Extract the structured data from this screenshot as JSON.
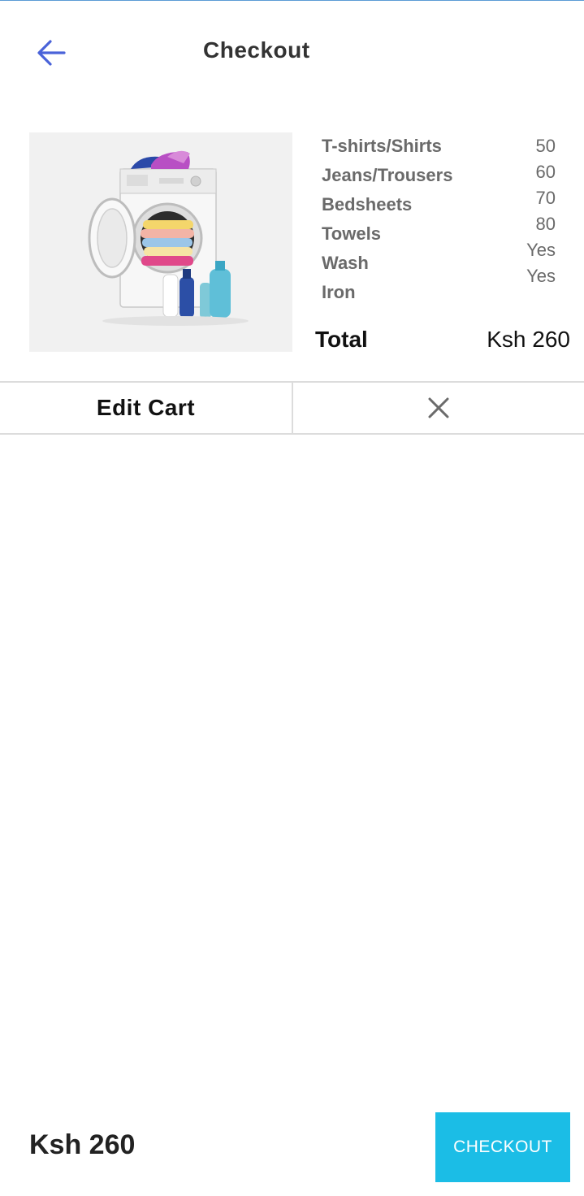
{
  "header": {
    "title": "Checkout",
    "back_icon": "arrow-left-icon",
    "back_icon_color": "#4a63d9"
  },
  "product": {
    "image": "washing-machine-with-laundry",
    "items": [
      {
        "label": "T-shirts/Shirts",
        "value": "50"
      },
      {
        "label": "Jeans/Trousers",
        "value": "60"
      },
      {
        "label": "Bedsheets",
        "value": "70"
      },
      {
        "label": "Towels",
        "value": "80"
      },
      {
        "label": "Wash",
        "value": "Yes"
      },
      {
        "label": "Iron",
        "value": "Yes"
      }
    ],
    "total_label": "Total",
    "total_value": "Ksh 260"
  },
  "actions": {
    "edit_cart_label": "Edit Cart",
    "remove_icon": "close-icon"
  },
  "footer": {
    "total": "Ksh 260",
    "checkout_label": "CHECKOUT",
    "checkout_color": "#1bbde6"
  }
}
